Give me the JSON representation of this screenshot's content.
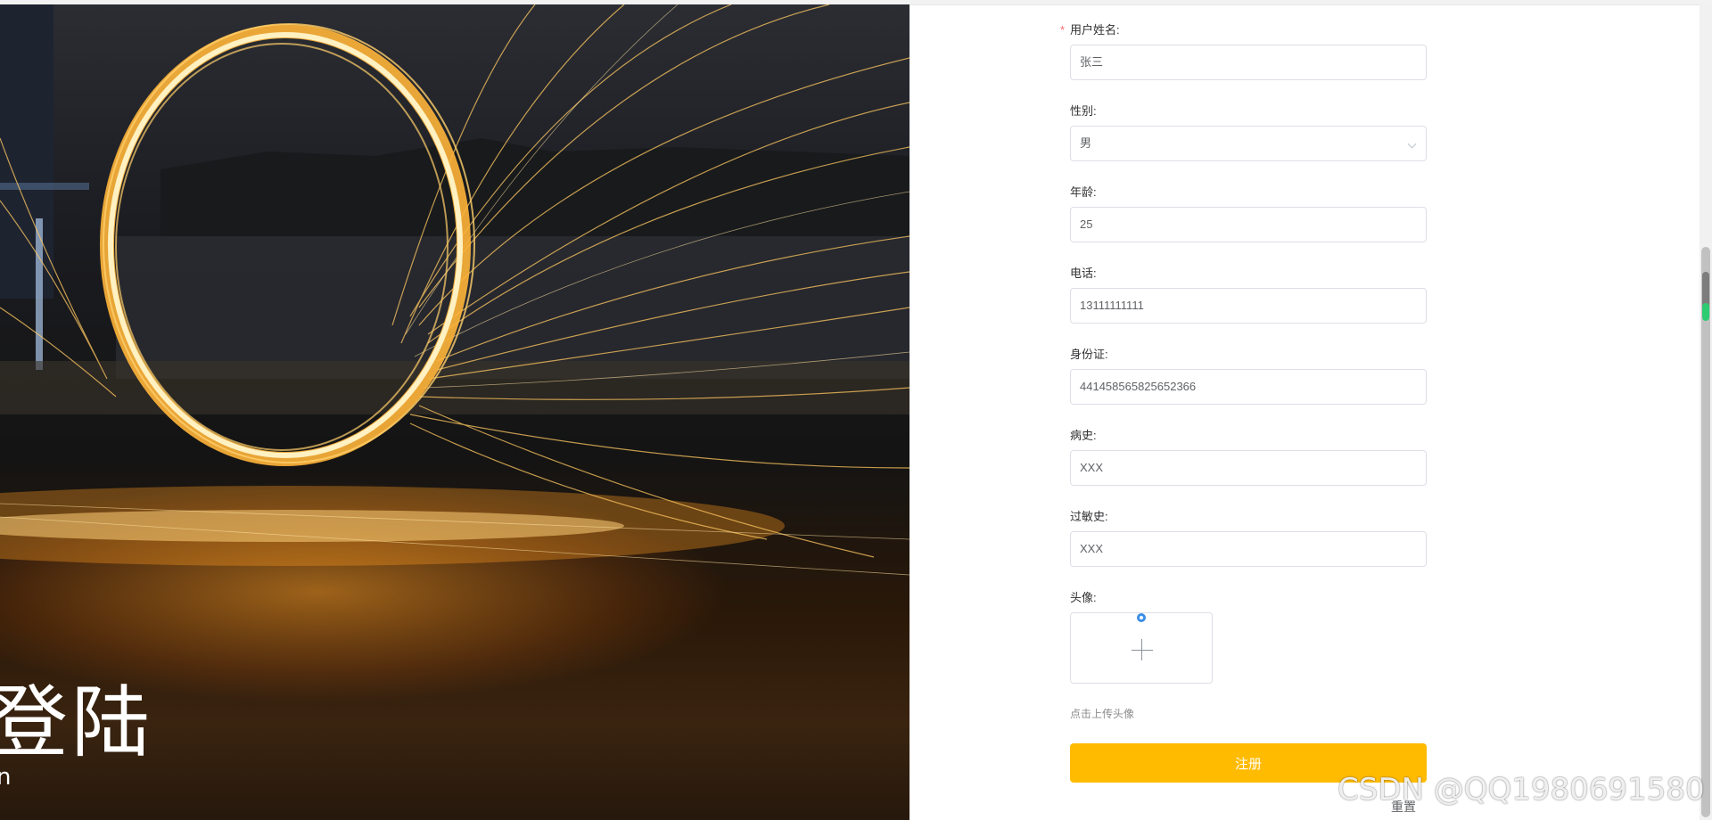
{
  "hero": {
    "title": "登陆",
    "subtitle": "n"
  },
  "form": {
    "name": {
      "label": "用户姓名:",
      "required_mark": "*",
      "value": "张三"
    },
    "gender": {
      "label": "性别:",
      "value": "男"
    },
    "age": {
      "label": "年龄:",
      "value": "25"
    },
    "phone": {
      "label": "电话:",
      "value": "13111111111"
    },
    "id_card": {
      "label": "身份证:",
      "value": "441458565825652366"
    },
    "medical_history": {
      "label": "病史:",
      "value": "XXX"
    },
    "allergy_history": {
      "label": "过敏史:",
      "value": "XXX"
    },
    "avatar": {
      "label": "头像:",
      "hint": "点击上传头像",
      "icon": "plus-icon"
    },
    "register_label": "注册",
    "reset_label": "重置"
  },
  "watermark": "CSDN @QQ1980691580",
  "colors": {
    "accent": "#ffbb00",
    "required": "#f56c6c",
    "border": "#dcdfe6"
  }
}
